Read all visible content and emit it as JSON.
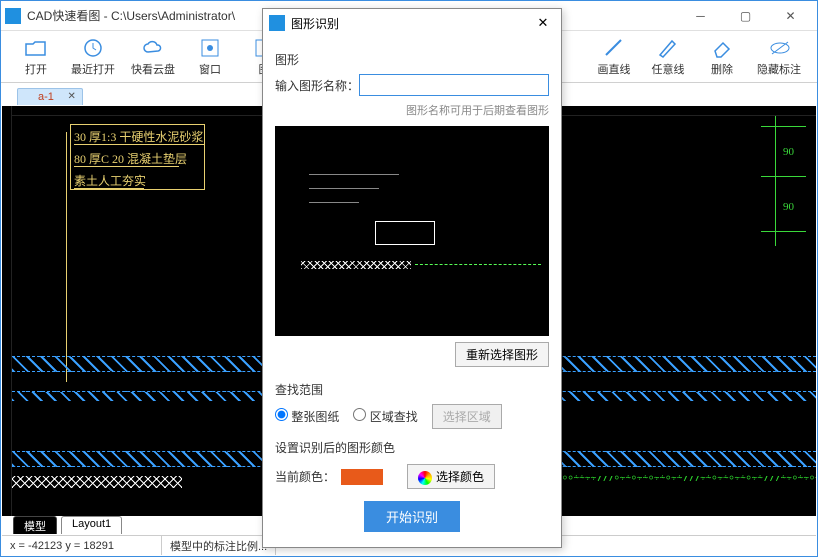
{
  "window": {
    "title": "CAD快速看图 - C:\\Users\\Administrator\\"
  },
  "toolbar": {
    "open": "打开",
    "recent": "最近打开",
    "cloud": "快看云盘",
    "window": "窗口",
    "pattern": "图",
    "line": "画直线",
    "anyline": "任意线",
    "delete": "删除",
    "hide_annot": "隐藏标注"
  },
  "tab": {
    "name": "a-1"
  },
  "cad": {
    "t1": "30 厚1:3 干硬性水泥砂浆",
    "t2": "80 厚C 20 混凝土垫层",
    "t3": "素土人工夯实",
    "n1": "90",
    "n2": "90"
  },
  "bottom_tabs": {
    "model": "模型",
    "layout1": "Layout1"
  },
  "status": {
    "coords": "x = -42123  y = 18291",
    "note": "模型中的标注比例..."
  },
  "dialog": {
    "title": "图形识别",
    "section_shape": "图形",
    "input_label": "输入图形名称：",
    "input_value": "",
    "hint": "图形名称可用于后期查看图形",
    "reselect": "重新选择图形",
    "search_scope": "查找范围",
    "radio_whole": "整张图纸",
    "radio_area": "区域查找",
    "select_area": "选择区域",
    "color_section": "设置识别后的图形颜色",
    "current_color": "当前颜色：",
    "choose_color": "选择颜色",
    "start": "开始识别"
  }
}
